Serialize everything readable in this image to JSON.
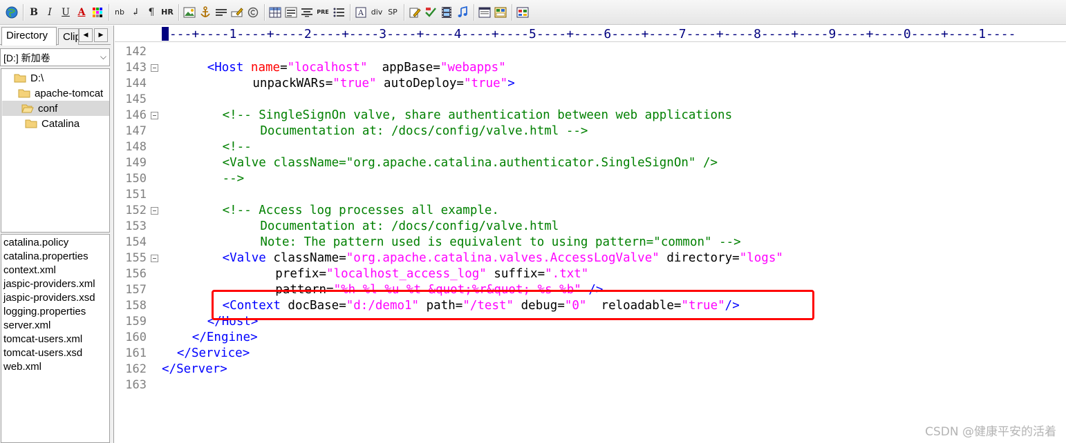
{
  "toolbar": {
    "bold": "B",
    "italic": "I",
    "underline": "U",
    "font_color": "A",
    "nbsp": "nb",
    "linebreak": "↲",
    "paragraph": "¶",
    "horizontal_rule": "HR",
    "pre": "PRE",
    "div": "div",
    "span": "SP"
  },
  "left_panel": {
    "tab_directory": "Directory",
    "tab_clipboard": "Clip",
    "drive": "[D:] 新加卷",
    "tree": [
      "D:\\",
      "apache-tomcat",
      "conf",
      "Catalina"
    ],
    "files": [
      "catalina.policy",
      "catalina.properties",
      "context.xml",
      "jaspic-providers.xml",
      "jaspic-providers.xsd",
      "logging.properties",
      "server.xml",
      "tomcat-users.xml",
      "tomcat-users.xsd",
      "web.xml"
    ]
  },
  "editor": {
    "ruler": "----+----1----+----2----+----3----+----4----+----5----+----6----+----7----+----8----+----9----+----0----+----1----",
    "lines": [
      {
        "n": "142",
        "fold": false,
        "indent": 0,
        "segs": []
      },
      {
        "n": "143",
        "fold": true,
        "indent": 6,
        "segs": [
          [
            "t",
            "<Host "
          ],
          [
            "ar",
            "name"
          ],
          [
            "a",
            "="
          ],
          [
            "v",
            "\"localhost\""
          ],
          [
            "a",
            "  "
          ],
          [
            "a",
            "appBase"
          ],
          [
            "a",
            "="
          ],
          [
            "v",
            "\"webapps\""
          ]
        ]
      },
      {
        "n": "144",
        "fold": false,
        "indent": 12,
        "segs": [
          [
            "a",
            "unpackWARs"
          ],
          [
            "a",
            "="
          ],
          [
            "v",
            "\"true\""
          ],
          [
            "a",
            " autoDeploy"
          ],
          [
            "a",
            "="
          ],
          [
            "v",
            "\"true\""
          ],
          [
            "t",
            ">"
          ]
        ]
      },
      {
        "n": "145",
        "fold": false,
        "indent": 0,
        "segs": []
      },
      {
        "n": "146",
        "fold": true,
        "indent": 8,
        "segs": [
          [
            "c",
            "<!-- SingleSignOn valve, share authentication between web applications"
          ]
        ]
      },
      {
        "n": "147",
        "fold": false,
        "indent": 13,
        "segs": [
          [
            "c",
            "Documentation at: /docs/config/valve.html -->"
          ]
        ]
      },
      {
        "n": "148",
        "fold": false,
        "indent": 8,
        "segs": [
          [
            "c",
            "<!--"
          ]
        ]
      },
      {
        "n": "149",
        "fold": false,
        "indent": 8,
        "segs": [
          [
            "c",
            "<Valve className=\"org.apache.catalina.authenticator.SingleSignOn\" />"
          ]
        ]
      },
      {
        "n": "150",
        "fold": false,
        "indent": 8,
        "segs": [
          [
            "c",
            "-->"
          ]
        ]
      },
      {
        "n": "151",
        "fold": false,
        "indent": 0,
        "segs": []
      },
      {
        "n": "152",
        "fold": true,
        "indent": 8,
        "segs": [
          [
            "c",
            "<!-- Access log processes all example."
          ]
        ]
      },
      {
        "n": "153",
        "fold": false,
        "indent": 13,
        "segs": [
          [
            "c",
            "Documentation at: /docs/config/valve.html"
          ]
        ]
      },
      {
        "n": "154",
        "fold": false,
        "indent": 13,
        "segs": [
          [
            "c",
            "Note: The pattern used is equivalent to using pattern=\"common\" -->"
          ]
        ]
      },
      {
        "n": "155",
        "fold": true,
        "indent": 8,
        "segs": [
          [
            "t",
            "<Valve "
          ],
          [
            "a",
            "className"
          ],
          [
            "a",
            "="
          ],
          [
            "v",
            "\"org.apache.catalina.valves.AccessLogValve\""
          ],
          [
            "a",
            " directory"
          ],
          [
            "a",
            "="
          ],
          [
            "v",
            "\"logs\""
          ]
        ]
      },
      {
        "n": "156",
        "fold": false,
        "indent": 15,
        "segs": [
          [
            "a",
            "prefix"
          ],
          [
            "a",
            "="
          ],
          [
            "v",
            "\"localhost_access_log\""
          ],
          [
            "a",
            " suffix"
          ],
          [
            "a",
            "="
          ],
          [
            "v",
            "\".txt\""
          ]
        ]
      },
      {
        "n": "157",
        "fold": false,
        "indent": 15,
        "segs": [
          [
            "a",
            "pattern"
          ],
          [
            "a",
            "="
          ],
          [
            "v",
            "\"%h %l %u %t &quot;%r&quot; %s %b\""
          ],
          [
            "t",
            " />"
          ]
        ]
      },
      {
        "n": "158",
        "fold": false,
        "indent": 8,
        "segs": [
          [
            "t",
            "<Context "
          ],
          [
            "a",
            "docBase"
          ],
          [
            "a",
            "="
          ],
          [
            "v",
            "\"d:/demo1\""
          ],
          [
            "a",
            " path"
          ],
          [
            "a",
            "="
          ],
          [
            "v",
            "\"/test\""
          ],
          [
            "a",
            " debug"
          ],
          [
            "a",
            "="
          ],
          [
            "v",
            "\"0\""
          ],
          [
            "a",
            "  reloadable"
          ],
          [
            "a",
            "="
          ],
          [
            "v",
            "\"true\""
          ],
          [
            "t",
            "/>"
          ]
        ]
      },
      {
        "n": "159",
        "fold": false,
        "indent": 6,
        "segs": [
          [
            "t",
            "</Host>"
          ]
        ]
      },
      {
        "n": "160",
        "fold": false,
        "indent": 4,
        "segs": [
          [
            "t",
            "</Engine>"
          ]
        ]
      },
      {
        "n": "161",
        "fold": false,
        "indent": 2,
        "segs": [
          [
            "t",
            "</Service>"
          ]
        ]
      },
      {
        "n": "162",
        "fold": false,
        "indent": 0,
        "segs": [
          [
            "t",
            "</Server>"
          ]
        ]
      },
      {
        "n": "163",
        "fold": false,
        "indent": 0,
        "segs": []
      }
    ]
  },
  "watermark": "CSDN @健康平安的活着",
  "colors": {
    "tag": "#0000ff",
    "attr_name_first": "#ff0000",
    "value": "#ff00ff",
    "comment": "#008000",
    "line_number": "#808080",
    "highlight_box": "#ff0000"
  }
}
